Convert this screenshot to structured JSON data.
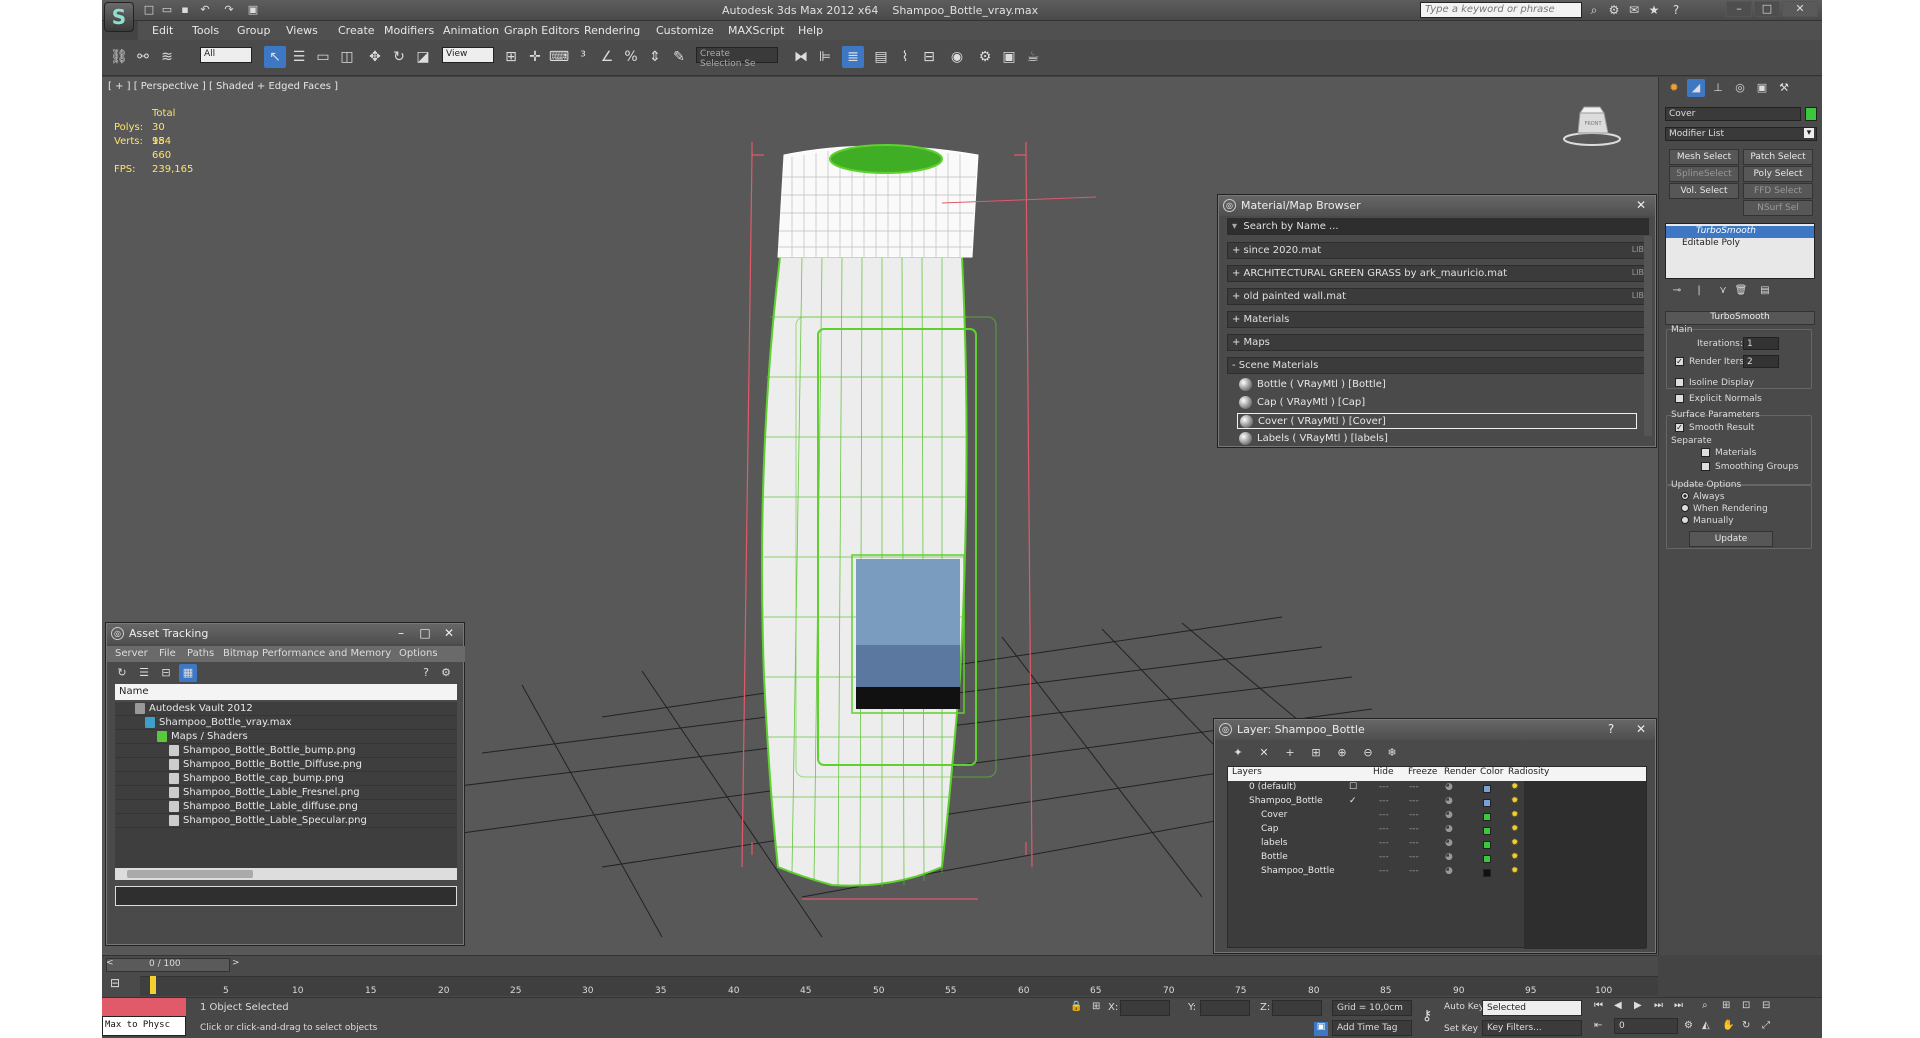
{
  "window": {
    "app_title": "Autodesk 3ds Max  2012 x64",
    "file_title": "Shampoo_Bottle_vray.max",
    "search_placeholder": "Type a keyword or phrase"
  },
  "menu": [
    "Edit",
    "Tools",
    "Group",
    "Views",
    "Create",
    "Modifiers",
    "Animation",
    "Graph Editors",
    "Rendering",
    "Customize",
    "MAXScript",
    "Help"
  ],
  "toolbar": {
    "filter_value": "All",
    "refcoord_value": "View",
    "selection_set_placeholder": "Create Selection Se"
  },
  "viewport": {
    "label": "[ + ] [ Perspective ] [ Shaded + Edged Faces ]",
    "stats_header": "Total",
    "polys_label": "Polys:",
    "polys_value": "30 984",
    "verts_label": "Verts:",
    "verts_value": "15 660",
    "fps_label": "FPS:",
    "fps_value": "239,165",
    "viewcube_label": "FRONT"
  },
  "material_browser": {
    "title": "Material/Map Browser",
    "search_placeholder": "Search by Name ...",
    "groups": [
      {
        "label": "+ since 2020.mat",
        "tag": "LIB"
      },
      {
        "label": "+ ARCHITECTURAL GREEN GRASS by ark_mauricio.mat",
        "tag": "LIB"
      },
      {
        "label": "+ old painted wall.mat",
        "tag": "LIB"
      },
      {
        "label": "+ Materials",
        "tag": ""
      },
      {
        "label": "+ Maps",
        "tag": ""
      },
      {
        "label": "- Scene Materials",
        "tag": ""
      }
    ],
    "materials": [
      {
        "label": "Bottle  ( VRayMtl )  [Bottle]",
        "selected": false
      },
      {
        "label": "Cap  ( VRayMtl )  [Cap]",
        "selected": false
      },
      {
        "label": "Cover  ( VRayMtl )  [Cover]",
        "selected": true
      },
      {
        "label": "Labels  ( VRayMtl )  [labels]",
        "selected": false
      }
    ]
  },
  "asset_tracking": {
    "title": "Asset Tracking",
    "menu": [
      "Server",
      "File",
      "Paths",
      "Bitmap Performance and Memory",
      "Options"
    ],
    "column": "Name",
    "rows": [
      {
        "label": "Autodesk Vault 2012",
        "indent": 0
      },
      {
        "label": "Shampoo_Bottle_vray.max",
        "indent": 1
      },
      {
        "label": "Maps / Shaders",
        "indent": 2
      },
      {
        "label": "Shampoo_Bottle_Bottle_bump.png",
        "indent": 3
      },
      {
        "label": "Shampoo_Bottle_Bottle_Diffuse.png",
        "indent": 3
      },
      {
        "label": "Shampoo_Bottle_cap_bump.png",
        "indent": 3
      },
      {
        "label": "Shampoo_Bottle_Lable_Fresnel.png",
        "indent": 3
      },
      {
        "label": "Shampoo_Bottle_Lable_diffuse.png",
        "indent": 3
      },
      {
        "label": "Shampoo_Bottle_Lable_Specular.png",
        "indent": 3
      }
    ]
  },
  "layer_panel": {
    "title": "Layer: Shampoo_Bottle",
    "columns": [
      "Layers",
      "Hide",
      "Freeze",
      "Render",
      "Color",
      "Radiosity"
    ],
    "rows": [
      {
        "label": "0 (default)",
        "color": "#7aa0d6",
        "indent": 0
      },
      {
        "label": "Shampoo_Bottle",
        "color": "#7aa0d6",
        "indent": 0
      },
      {
        "label": "Cover",
        "color": "#3cc83c",
        "indent": 1
      },
      {
        "label": "Cap",
        "color": "#3cc83c",
        "indent": 1
      },
      {
        "label": "labels",
        "color": "#3cc83c",
        "indent": 1
      },
      {
        "label": "Bottle",
        "color": "#3cc83c",
        "indent": 1
      },
      {
        "label": "Shampoo_Bottle",
        "color": "#111111",
        "indent": 1
      }
    ]
  },
  "command_panel": {
    "object_name": "Cover",
    "modifier_list": "Modifier List",
    "buttons": [
      "Mesh Select",
      "Patch Select",
      "SplineSelect",
      "Poly Select",
      "Vol. Select",
      "FFD Select",
      "NSurf Sel"
    ],
    "stack": [
      "TurboSmooth",
      "Editable Poly"
    ],
    "rollout_title": "TurboSmooth",
    "main_label": "Main",
    "iterations_label": "Iterations:",
    "iterations_value": "1",
    "render_iters_label": "Render Iters:",
    "render_iters_value": "2",
    "isoline": "Isoline Display",
    "explicit": "Explicit Normals",
    "surface_params": "Surface Parameters",
    "smooth_result": "Smooth Result",
    "separate": "Separate",
    "materials": "Materials",
    "smoothing_groups": "Smoothing Groups",
    "update_options": "Update Options",
    "always": "Always",
    "when_rendering": "When Rendering",
    "manually": "Manually",
    "update": "Update"
  },
  "timeline": {
    "frame": "0 / 100",
    "ticks": [
      "5",
      "10",
      "15",
      "20",
      "25",
      "30",
      "35",
      "40",
      "45",
      "50",
      "55",
      "60",
      "65",
      "70",
      "75",
      "80",
      "85",
      "90",
      "95",
      "100"
    ]
  },
  "status": {
    "maxscript": "Max to Physc",
    "selected": "1 Object Selected",
    "prompt": "Click or click-and-drag to select objects",
    "x_label": "X:",
    "y_label": "Y:",
    "z_label": "Z:",
    "grid": "Grid = 10,0cm",
    "add_time_tag": "Add Time Tag",
    "auto_key": "Auto Key",
    "set_key": "Set Key",
    "selected_dropdown": "Selected",
    "key_filters": "Key Filters...",
    "frame_value": "0"
  }
}
